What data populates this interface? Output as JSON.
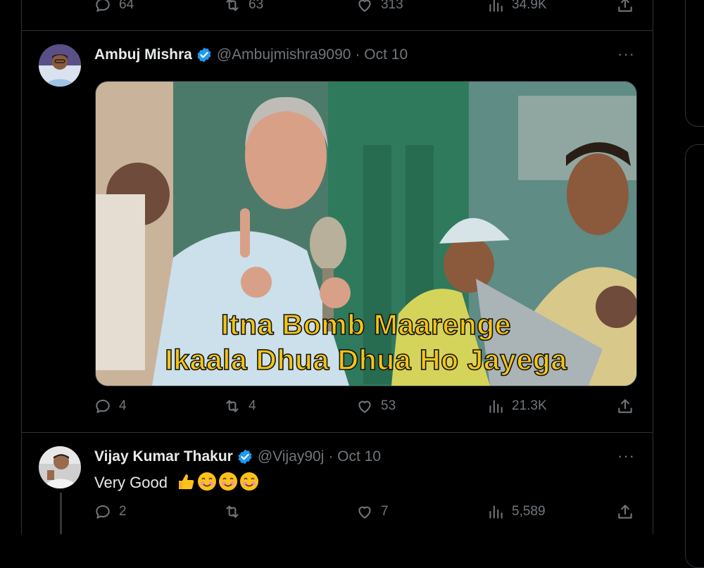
{
  "prev_tweet": {
    "actions": {
      "replies": "64",
      "retweets": "63",
      "likes": "313",
      "views": "34.9K"
    }
  },
  "tweet": {
    "author_name": "Ambuj Mishra",
    "handle": "@Ambujmishra9090",
    "date": "· Oct 10",
    "more": "···",
    "image_caption": {
      "line1": "Itna Bomb Maarenge",
      "line2": "Ikaala Dhua Dhua Ho Jayega"
    },
    "actions": {
      "replies": "4",
      "retweets": "4",
      "likes": "53",
      "views": "21.3K"
    }
  },
  "reply": {
    "author_name": "Vijay Kumar Thakur",
    "handle": "@Vijay90j",
    "date": "· Oct 10",
    "more": "···",
    "text": "Very Good",
    "actions": {
      "replies": "2",
      "retweets": "",
      "likes": "7",
      "views": "5,589"
    }
  },
  "colors": {
    "verified": "#1d9bf0",
    "muted": "#71767b",
    "border": "#2f3336",
    "caption": "#f2c418"
  },
  "icons": [
    "reply-icon",
    "retweet-icon",
    "like-icon",
    "views-icon",
    "share-icon",
    "verified-badge-icon",
    "more-icon",
    "thumbs-up-emoji",
    "smiling-emoji"
  ]
}
